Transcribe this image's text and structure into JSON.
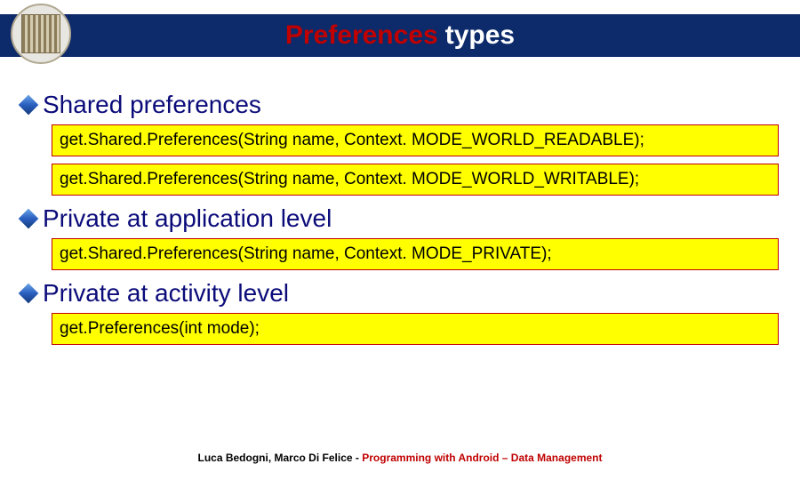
{
  "title": {
    "accent": "Preferences",
    "rest": "types"
  },
  "sections": [
    {
      "heading": "Shared preferences",
      "codes": [
        "get.Shared.Preferences(String name, Context. MODE_WORLD_READABLE);",
        "get.Shared.Preferences(String name, Context. MODE_WORLD_WRITABLE);"
      ]
    },
    {
      "heading": "Private at application level",
      "codes": [
        "get.Shared.Preferences(String name, Context. MODE_PRIVATE);"
      ]
    },
    {
      "heading": "Private at activity level",
      "codes": [
        "get.Preferences(int mode);"
      ]
    }
  ],
  "footer": {
    "authors": "Luca Bedogni, Marco Di Felice",
    "sep": " - ",
    "topic": "Programming with Android – Data Management"
  }
}
